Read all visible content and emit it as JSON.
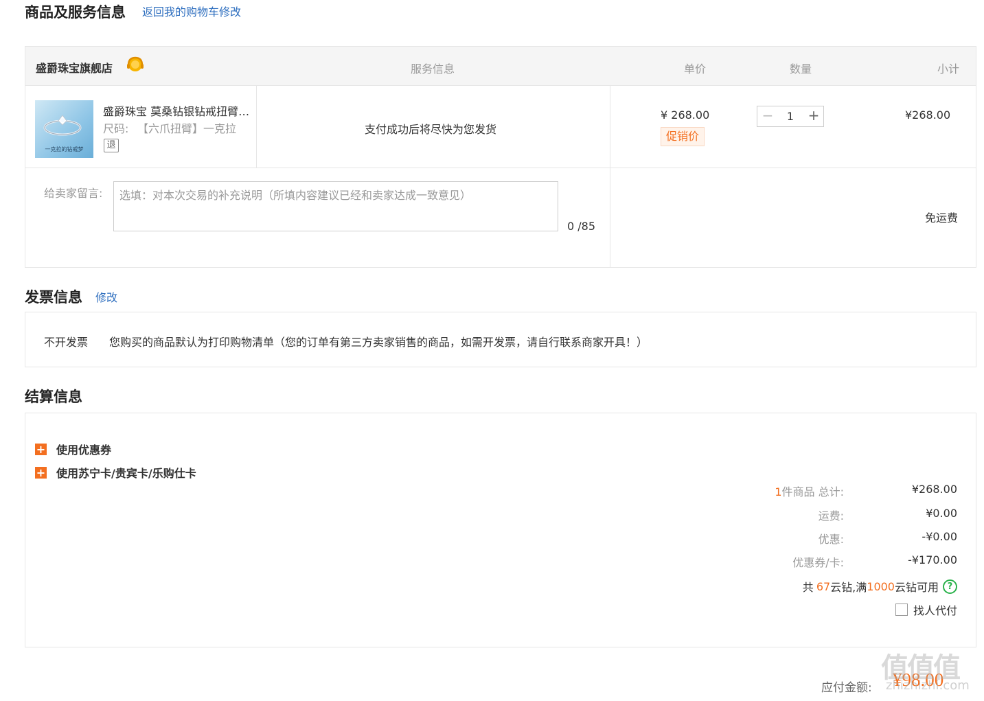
{
  "product_section": {
    "title": "商品及服务信息",
    "back_link": "返回我的购物车修改"
  },
  "table": {
    "store_name": "盛爵珠宝旗舰店",
    "headers": {
      "service": "服务信息",
      "unit_price": "单价",
      "quantity": "数量",
      "subtotal": "小计"
    },
    "item": {
      "image_caption": "一克拉的钻戒梦",
      "name": "盛爵珠宝 莫桑钻银钻戒扭臂…",
      "size_label": "尺码:",
      "size_value": "【六爪扭臂】一克拉",
      "return_badge": "退",
      "service_text": "支付成功后将尽快为您发货",
      "price": "¥ 268.00",
      "promo_badge": "促销价",
      "quantity": "1",
      "minus": "−",
      "plus": "+",
      "subtotal": "¥268.00"
    },
    "message": {
      "label": "给卖家留言:",
      "placeholder": "选填：对本次交易的补充说明（所填内容建议已经和卖家达成一致意见）",
      "counter": "0 /85",
      "shipping": "免运费"
    }
  },
  "invoice": {
    "title": "发票信息",
    "edit_link": "修改",
    "type": "不开发票",
    "note": "您购买的商品默认为打印购物清单（您的订单有第三方卖家销售的商品，如需开发票，请自行联系商家开具！）"
  },
  "settlement": {
    "title": "结算信息",
    "options": [
      {
        "label": "使用优惠券",
        "icon": "plus-square-icon"
      },
      {
        "label": "使用苏宁卡/贵宾卡/乐购仕卡",
        "icon": "plus-square-icon"
      }
    ],
    "summary": {
      "count_num": "1",
      "count_text": "件商品 总计:",
      "total": "¥268.00",
      "shipping_label": "运费:",
      "shipping": "¥0.00",
      "discount_label": "优惠:",
      "discount": "-¥0.00",
      "coupon_label": "优惠券/卡:",
      "coupon": "-¥170.00"
    },
    "diamonds": {
      "prefix": "共",
      "count": "67",
      "mid": "云钻,满",
      "threshold": "1000",
      "suffix": "云钻可用",
      "help_icon": "?"
    },
    "pay_for_me": "找人代付"
  },
  "payable": {
    "label": "应付金额:",
    "amount": "¥98.00"
  },
  "watermark": {
    "logo": "值值值",
    "url": "zhizhizhi.com"
  },
  "colors": {
    "accent": "#f36f20",
    "link": "#2f6fbf",
    "border": "#e6e6e6",
    "header_bg": "#f5f5f5",
    "help_green": "#2bb24c"
  }
}
